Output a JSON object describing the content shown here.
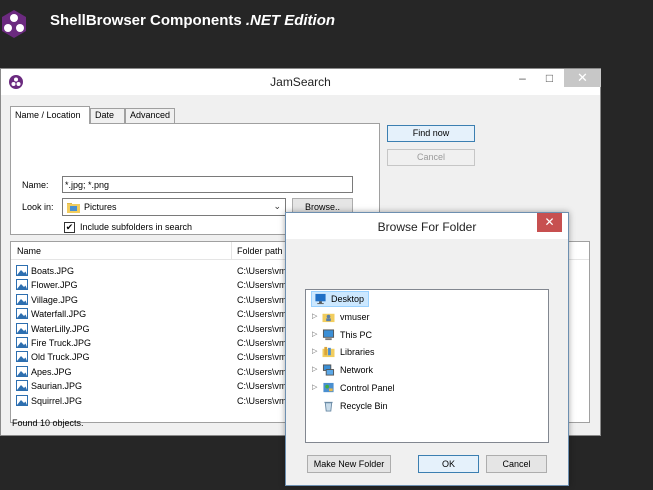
{
  "banner": {
    "title_main": "ShellBrowser Components ",
    "title_italic": ".NET Edition"
  },
  "window": {
    "title": "JamSearch",
    "minimize": "–",
    "maximize": "□",
    "close": "✕"
  },
  "tabs": [
    "Name / Location",
    "Date",
    "Advanced"
  ],
  "form": {
    "name_label": "Name:",
    "name_value": "*.jpg; *.png",
    "lookin_label": "Look in:",
    "lookin_value": "Pictures",
    "browse_button": "Browse..",
    "include_subfolders_label": "Include subfolders in search",
    "include_subfolders_checked": true
  },
  "actions": {
    "find_now": "Find now",
    "cancel": "Cancel"
  },
  "results": {
    "columns": [
      "Name",
      "Folder path"
    ],
    "rows": [
      {
        "name": "Boats.JPG",
        "path": "C:\\Users\\vm"
      },
      {
        "name": "Flower.JPG",
        "path": "C:\\Users\\vm"
      },
      {
        "name": "Village.JPG",
        "path": "C:\\Users\\vm"
      },
      {
        "name": "Waterfall.JPG",
        "path": "C:\\Users\\vm"
      },
      {
        "name": "WaterLilly.JPG",
        "path": "C:\\Users\\vm"
      },
      {
        "name": "Fire Truck.JPG",
        "path": "C:\\Users\\vm"
      },
      {
        "name": "Old Truck.JPG",
        "path": "C:\\Users\\vm"
      },
      {
        "name": "Apes.JPG",
        "path": "C:\\Users\\vm"
      },
      {
        "name": "Saurian.JPG",
        "path": "C:\\Users\\vm"
      },
      {
        "name": "Squirrel.JPG",
        "path": "C:\\Users\\vm"
      }
    ],
    "status": "Found 10 objects."
  },
  "browse_dialog": {
    "title": "Browse For Folder",
    "close": "✕",
    "tree": [
      {
        "label": "Desktop",
        "icon": "desktop-icon",
        "selected": true
      },
      {
        "label": "vmuser",
        "icon": "user-folder-icon"
      },
      {
        "label": "This PC",
        "icon": "computer-icon"
      },
      {
        "label": "Libraries",
        "icon": "libraries-icon"
      },
      {
        "label": "Network",
        "icon": "network-icon"
      },
      {
        "label": "Control Panel",
        "icon": "control-panel-icon"
      },
      {
        "label": "Recycle Bin",
        "icon": "recycle-bin-icon"
      }
    ],
    "make_new_folder": "Make New Folder",
    "ok": "OK",
    "cancel": "Cancel"
  },
  "colors": {
    "background": "#262626",
    "selection": "#cce8ff",
    "close_button": "#c75050"
  }
}
